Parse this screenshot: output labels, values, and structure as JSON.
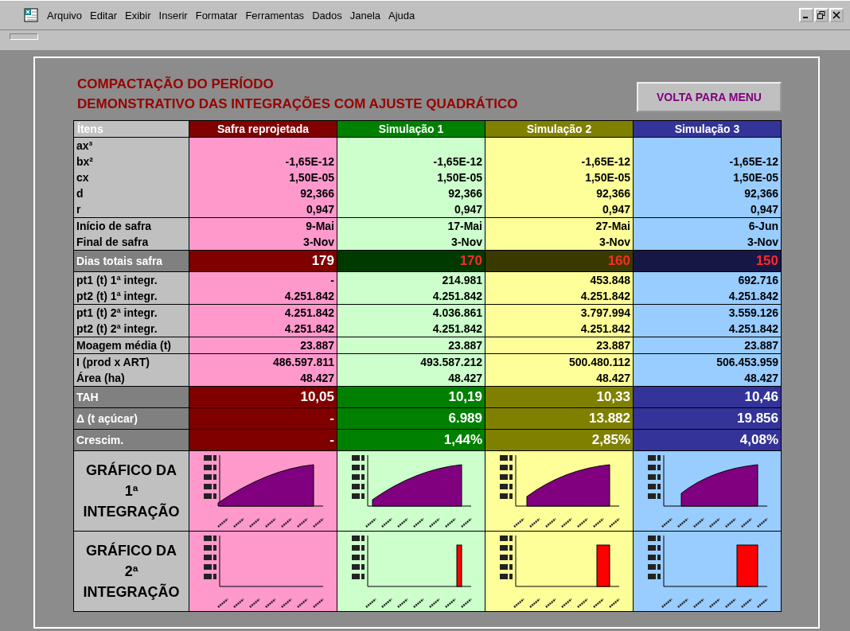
{
  "menu": {
    "items": [
      "Arquivo",
      "Editar",
      "Exibir",
      "Inserir",
      "Formatar",
      "Ferramentas",
      "Dados",
      "Janela",
      "Ajuda"
    ]
  },
  "sheet": {
    "title_lines": [
      "COMPACTAÇÃO DO PERÍODO",
      "DEMONSTRATIVO DAS INTEGRAÇÕES COM AJUSTE QUADRÁTICO"
    ],
    "button": "VOLTA PARA MENU"
  },
  "table": {
    "items_header": "Ítens",
    "columns": [
      {
        "label": "Safra reprojetada",
        "color": "#800000",
        "body": {
          "color": "#ff99cc"
        }
      },
      {
        "label": "Simulação 1",
        "color": "#008000",
        "body": {
          "color": "#ccffcc"
        }
      },
      {
        "label": "Simulação 2",
        "color": "#808000",
        "body": {
          "color": "#ffff99"
        }
      },
      {
        "label": "Simulação 3",
        "color": "#333399",
        "body": {
          "color": "#99ccff"
        }
      }
    ],
    "groups": [
      {
        "kind": "plain",
        "rows": [
          {
            "label": "ax³",
            "values": []
          },
          {
            "label": "bx²",
            "values": [
              "-1,65E-12",
              "-1,65E-12",
              "-1,65E-12",
              "-1,65E-12"
            ]
          },
          {
            "label": "cx",
            "values": [
              "1,50E-05",
              "1,50E-05",
              "1,50E-05",
              "1,50E-05"
            ]
          },
          {
            "label": "d",
            "values": [
              "92,366",
              "92,366",
              "92,366",
              "92,366"
            ]
          },
          {
            "label": "r",
            "values": [
              "0,947",
              "0,947",
              "0,947",
              "0,947"
            ]
          }
        ]
      },
      {
        "kind": "plain",
        "rows": [
          {
            "label": "Início de safra",
            "values": [
              "9-Mai",
              "17-Mai",
              "27-Mai",
              "6-Jun"
            ]
          },
          {
            "label": "Final de safra",
            "values": [
              "3-Nov",
              "3-Nov",
              "3-Nov",
              "3-Nov"
            ]
          }
        ]
      },
      {
        "kind": "dark",
        "rows": [
          {
            "label": "Dias totais safra",
            "cells": [
              {
                "text": "179",
                "red": false
              },
              {
                "text": "170",
                "red": true
              },
              {
                "text": "160",
                "red": true
              },
              {
                "text": "150",
                "red": true
              }
            ]
          }
        ]
      },
      {
        "kind": "plain",
        "rows": [
          {
            "label": "pt1 (t) 1ª integr.",
            "values": [
              "-",
              "214.981",
              "453.848",
              "692.716"
            ]
          },
          {
            "label": "pt2 (t) 1ª integr.",
            "values": [
              "4.251.842",
              "4.251.842",
              "4.251.842",
              "4.251.842"
            ]
          }
        ]
      },
      {
        "kind": "plain",
        "rows": [
          {
            "label": "pt1 (t) 2ª integr.",
            "values": [
              "4.251.842",
              "4.036.861",
              "3.797.994",
              "3.559.126"
            ]
          },
          {
            "label": "pt2 (t) 2ª integr.",
            "values": [
              "4.251.842",
              "4.251.842",
              "4.251.842",
              "4.251.842"
            ]
          }
        ]
      },
      {
        "kind": "plain",
        "rows": [
          {
            "label": "Moagem média (t)",
            "values": [
              "23.887",
              "23.887",
              "23.887",
              "23.887"
            ]
          }
        ]
      },
      {
        "kind": "plain",
        "rows": [
          {
            "label": "I (prod x ART)",
            "values": [
              "486.597.811",
              "493.587.212",
              "500.480.112",
              "506.453.959"
            ]
          },
          {
            "label": "Área (ha)",
            "values": [
              "48.427",
              "48.427",
              "48.427",
              "48.427"
            ]
          }
        ]
      },
      {
        "kind": "dark",
        "rows": [
          {
            "label": "TAH",
            "cells": [
              {
                "text": "10,05",
                "red": false
              },
              {
                "text": "10,19",
                "red": false
              },
              {
                "text": "10,33",
                "red": false
              },
              {
                "text": "10,46",
                "red": false
              }
            ]
          }
        ]
      },
      {
        "kind": "dark",
        "rows": [
          {
            "label": "Δ (t açúcar)",
            "cells": [
              {
                "text": "-",
                "red": false
              },
              {
                "text": "6.989",
                "red": false
              },
              {
                "text": "13.882",
                "red": false
              },
              {
                "text": "19.856",
                "red": false
              }
            ]
          }
        ]
      },
      {
        "kind": "dark",
        "rows": [
          {
            "label": "Crescim.",
            "cells": [
              {
                "text": "-",
                "red": false
              },
              {
                "text": "1,44%",
                "red": false
              },
              {
                "text": "2,85%",
                "red": false
              },
              {
                "text": "4,08%",
                "red": false
              }
            ]
          }
        ]
      },
      {
        "kind": "area-chart",
        "label_lines": [
          "GRÁFICO DA",
          "1ª",
          "INTEGRAÇÃO"
        ]
      },
      {
        "kind": "bar-chart",
        "label_lines": [
          "GRÁFICO DA",
          "2ª",
          "INTEGRAÇÃO"
        ]
      }
    ]
  }
}
